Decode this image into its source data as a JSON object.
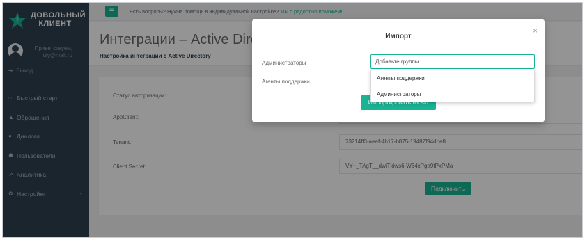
{
  "brand": {
    "line1": "ДОВОЛЬНЫЙ",
    "line2": "КЛИЕНТ"
  },
  "profile": {
    "greeting": "Приветствуем,",
    "email": "uly@mail.ru"
  },
  "logout": {
    "label": "Выход"
  },
  "nav": [
    {
      "label": "Быстрый старт",
      "icon": "home-icon"
    },
    {
      "label": "Обращения",
      "icon": "warning-icon"
    },
    {
      "label": "Диалоги",
      "icon": "chat-icon"
    },
    {
      "label": "Пользователи",
      "icon": "users-icon"
    },
    {
      "label": "Аналитика",
      "icon": "chart-icon"
    },
    {
      "label": "Настройки",
      "icon": "gear-icon"
    }
  ],
  "topbar": {
    "question": "Есть вопросы? Нужна помощь в индивидуальной настройке?",
    "link": "Мы с радостью поможем!"
  },
  "heading": {
    "title": "Интеграции – Active Directory",
    "subtitle": "Настройка интеграции с Active Directory"
  },
  "form": {
    "auth_status_label": "Статус авторизации:",
    "appclient_label": "AppClient:",
    "tenant_label": "Tenant:",
    "tenant_value": "73214ff3-aeaf-4b17-b875-19487f94dbe8",
    "secret_label": "Client Secret:",
    "secret_value": "VY~_TAgT__dwiTxiws6-W64xPga9tPxPMa",
    "connect_button": "Подключить"
  },
  "modal": {
    "title": "Импорт",
    "admins_label": "Администраторы",
    "agents_label": "Агенты поддержки",
    "groups_placeholder": "Добавьте группы",
    "import_button": "Импортировать из AD",
    "dropdown_options": [
      "Агенты поддержки",
      "Администраторы"
    ]
  },
  "colors": {
    "accent": "#1ab394",
    "sidebar": "#2f4050"
  }
}
